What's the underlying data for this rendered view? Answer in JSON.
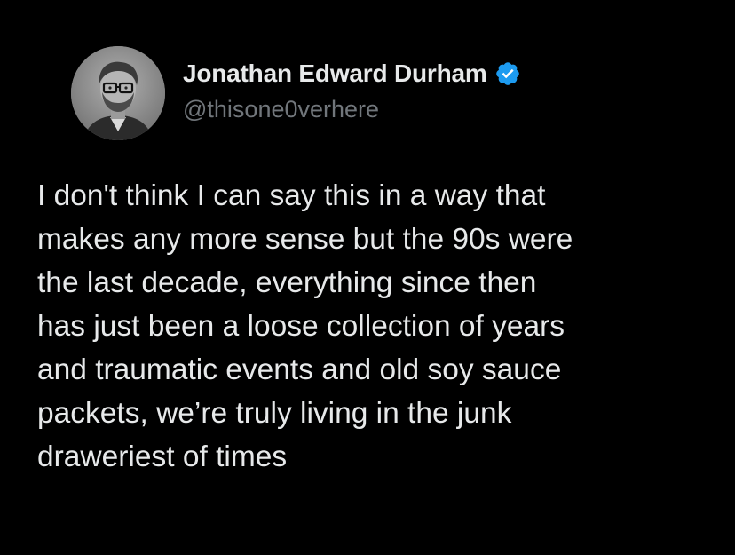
{
  "author": {
    "display_name": "Jonathan Edward Durham",
    "handle": "@thisone0verhere",
    "verified": true,
    "verified_color": "#1d9bf0"
  },
  "tweet": {
    "lines": [
      "I don't think I can say this in a way that",
      "makes any more sense but the 90s were",
      "the last decade, everything since then",
      "has just been a loose collection of years",
      "and traumatic events and old soy sauce",
      "packets, we’re truly living in the junk",
      "draweriest of times"
    ]
  },
  "icons": {
    "avatar": "profile-photo",
    "verified": "verified-badge-icon"
  },
  "colors": {
    "background": "#000000",
    "text": "#e7e9ea",
    "handle": "#71767b",
    "accent": "#1d9bf0"
  }
}
